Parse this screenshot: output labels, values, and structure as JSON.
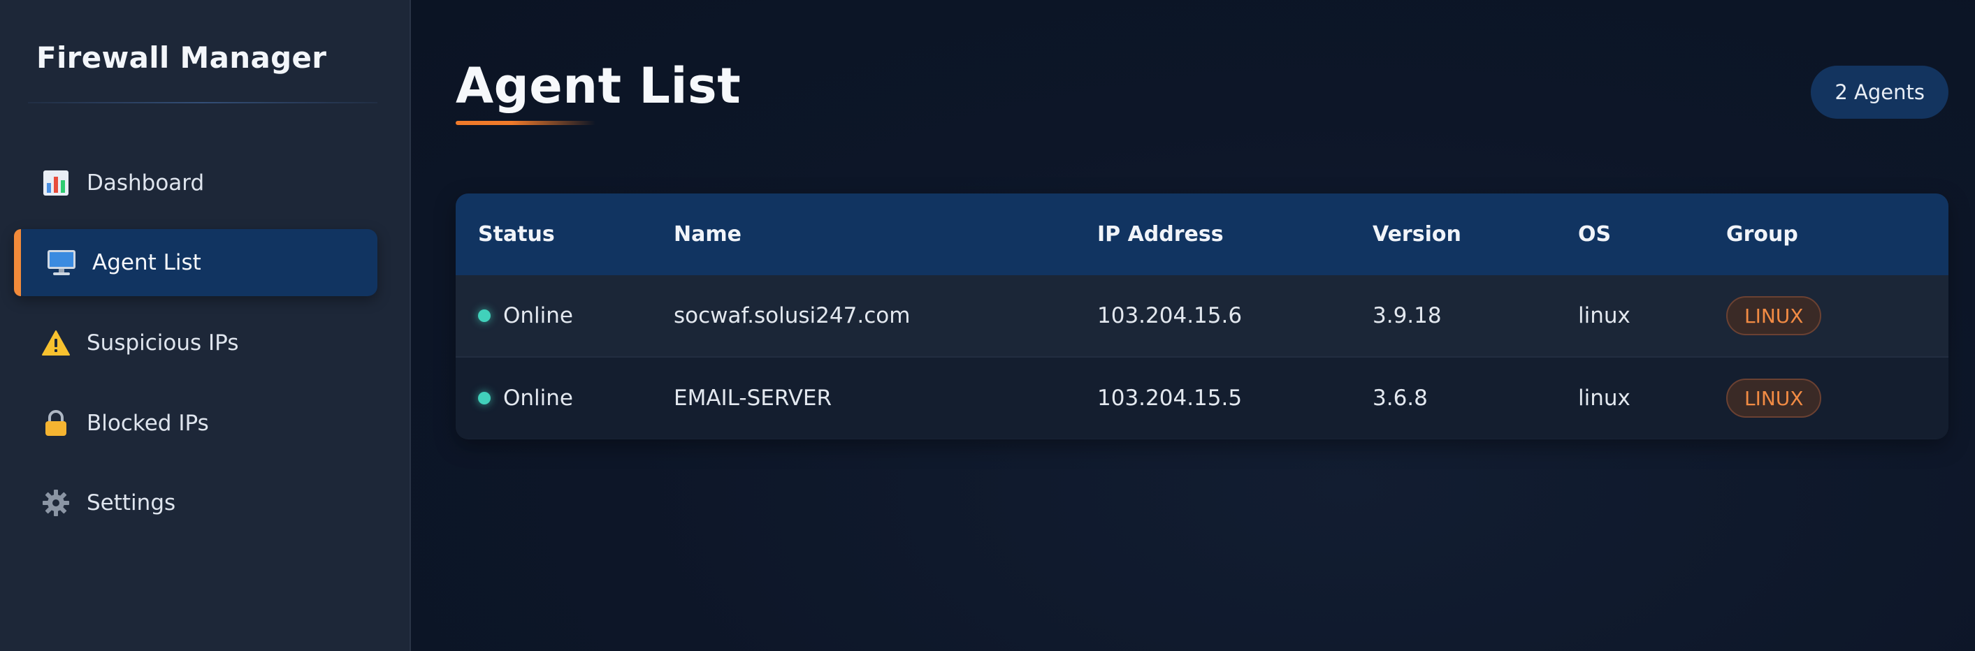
{
  "sidebar": {
    "brand": "Firewall Manager",
    "items": [
      {
        "label": "Dashboard",
        "icon": "bar-chart-icon",
        "active": false
      },
      {
        "label": "Agent List",
        "icon": "computer-icon",
        "active": true
      },
      {
        "label": "Suspicious IPs",
        "icon": "warning-icon",
        "active": false
      },
      {
        "label": "Blocked IPs",
        "icon": "lock-icon",
        "active": false
      },
      {
        "label": "Settings",
        "icon": "gear-icon",
        "active": false
      }
    ]
  },
  "main": {
    "title": "Agent List",
    "count_badge": "2 Agents",
    "table": {
      "columns": [
        "Status",
        "Name",
        "IP Address",
        "Version",
        "OS",
        "Group"
      ],
      "rows": [
        {
          "status": "Online",
          "name": "socwaf.solusi247.com",
          "ip": "103.204.15.6",
          "version": "3.9.18",
          "os": "linux",
          "group": "LINUX"
        },
        {
          "status": "Online",
          "name": "EMAIL-SERVER",
          "ip": "103.204.15.5",
          "version": "3.6.8",
          "os": "linux",
          "group": "LINUX"
        }
      ]
    }
  },
  "colors": {
    "accent": "#f07a2a",
    "active_nav": "#113461",
    "online": "#41d1bb",
    "sidebar_bg": "#1d2738",
    "main_bg": "#0e1829"
  }
}
